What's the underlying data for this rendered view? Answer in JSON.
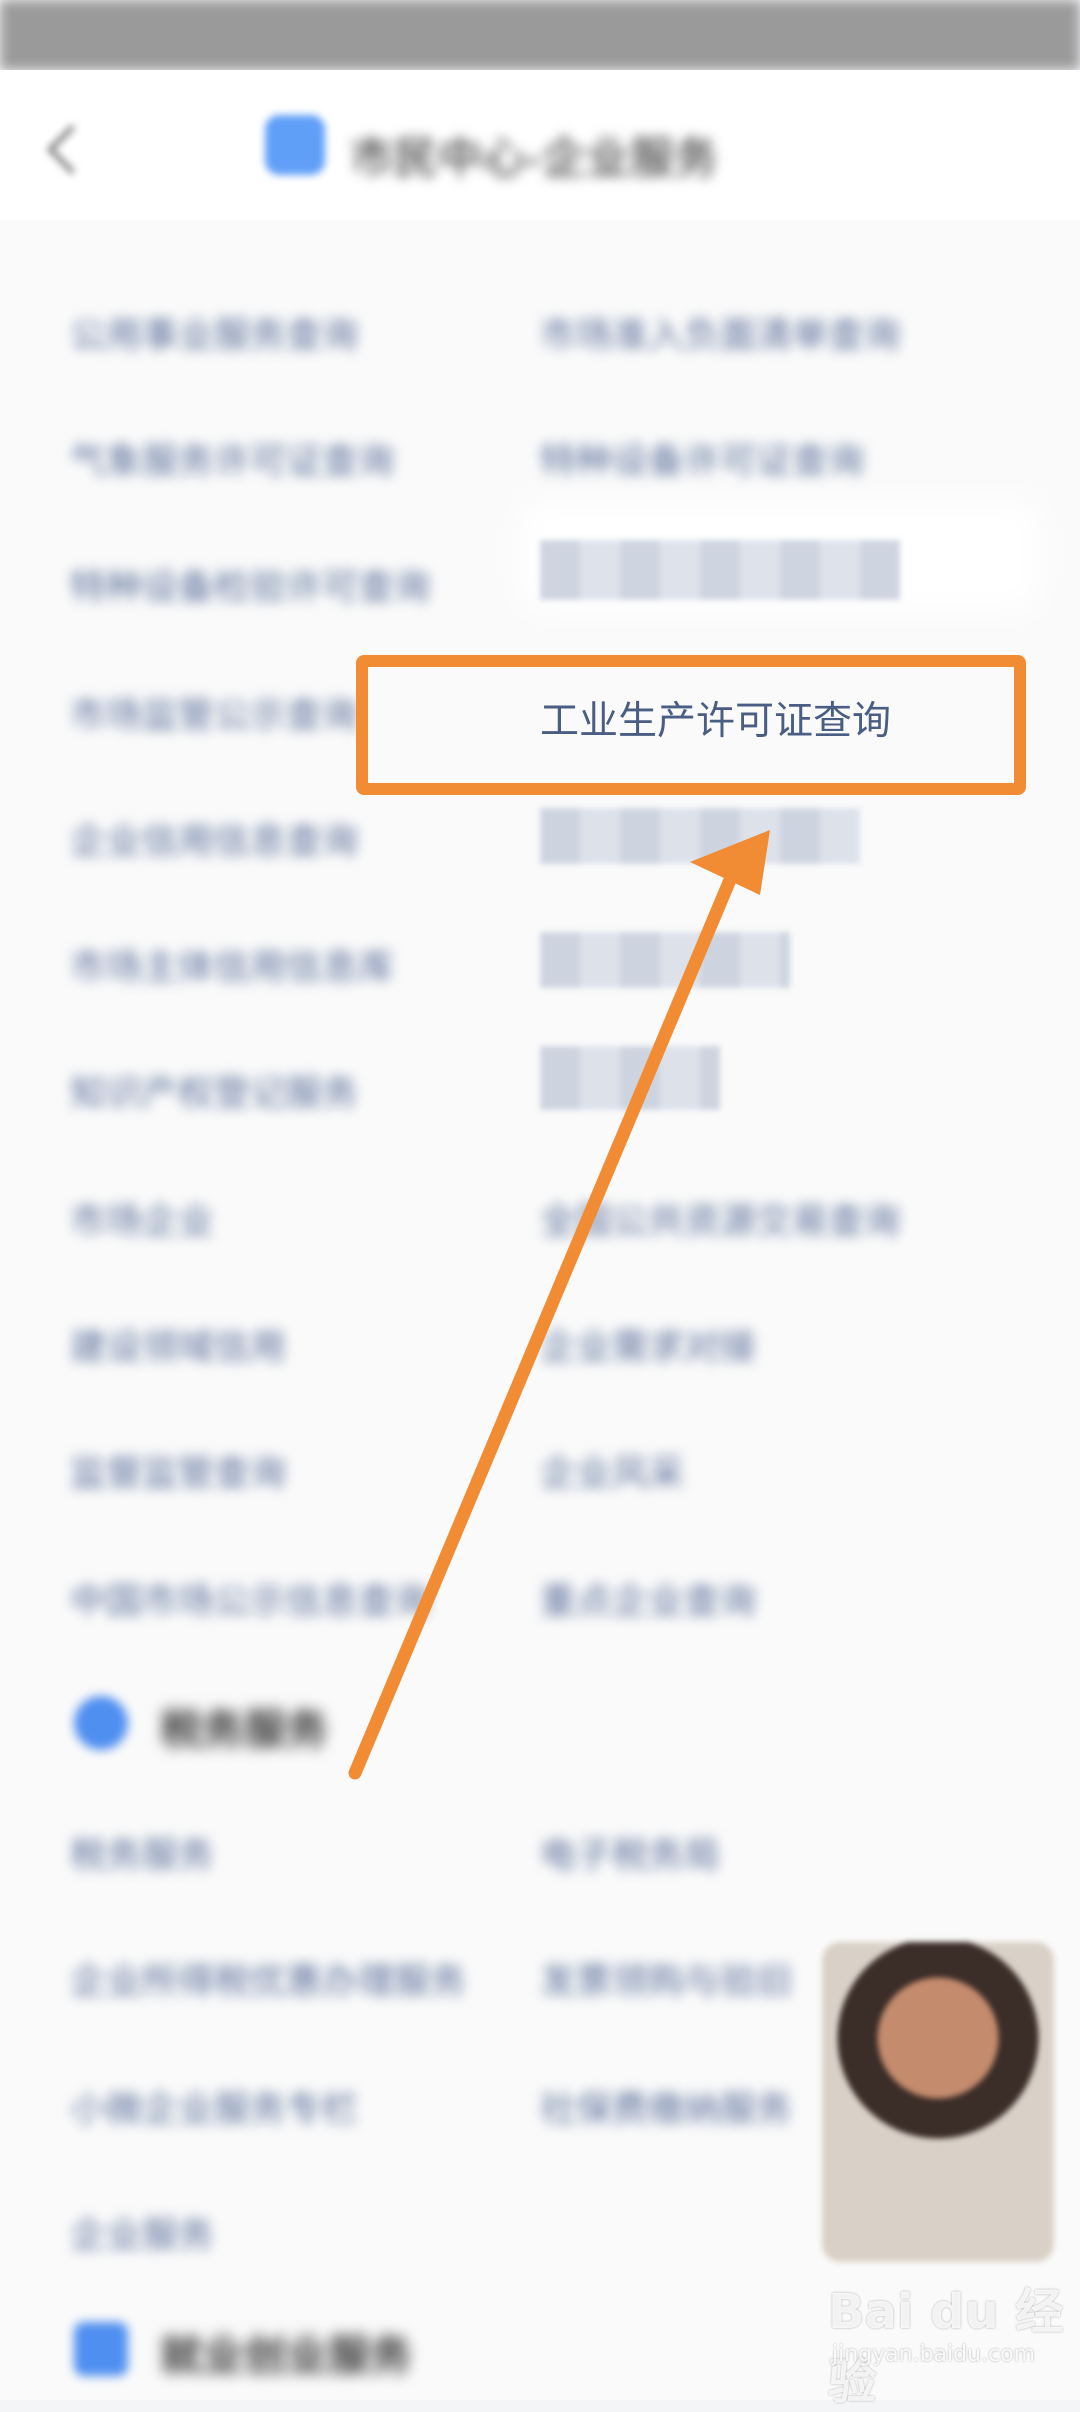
{
  "header": {
    "title": "市民中心-企业服务"
  },
  "services": {
    "left_column": [
      "公用事业服务查询",
      "气象服务许可证查询",
      "特种设备检验许可查询",
      "市场监管公示查询",
      "企业信用信息查询",
      "市场主体信用信息库",
      "知识产权登记服务",
      "市场企业",
      "建设领域信用",
      "监督监管查询",
      "中国市场公示信息查询"
    ],
    "right_column": [
      "市场准入负面清单查询",
      "特种设备许可证查询",
      "",
      "工业生产许可证查询",
      "",
      "",
      "",
      "全国公共资源交易查询",
      "企业需求对接",
      "企业风采",
      "重点企业查询"
    ],
    "highlighted_item": "工业生产许可证查询"
  },
  "section_2": {
    "title": "税务服务",
    "left_column": [
      "税务服务",
      "企业所得税优惠办理服务",
      "小微企业服务专栏",
      "企业服务"
    ],
    "right_column": [
      "电子税务局",
      "发票领购与验旧",
      "社保费缴纳服务"
    ]
  },
  "section_3": {
    "title": "就业创业服务"
  },
  "watermark": {
    "logo": "Bai du 经验",
    "url": "jingyan.baidu.com"
  },
  "colors": {
    "annotation": "#f18c34",
    "accent": "#4f8ff0",
    "link_text": "#5a6f9a"
  },
  "icons": {
    "back": "back-arrow-icon",
    "app": "app-icon",
    "section": "section-icon"
  }
}
